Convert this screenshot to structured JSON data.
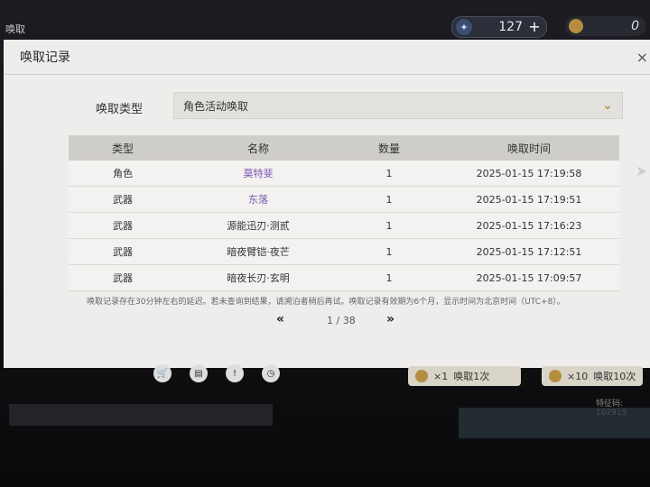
{
  "top": {
    "corner_label": "唤取",
    "currency": {
      "icon": "star-gem-icon",
      "value": "127",
      "plus": "+"
    },
    "currency2": {
      "icon": "coin-icon",
      "value": "0"
    }
  },
  "modal": {
    "title": "唤取记录",
    "close": "×",
    "type_label": "唤取类型",
    "type_value": "角色活动唤取",
    "columns": [
      "类型",
      "名称",
      "数量",
      "唤取时间"
    ],
    "rows": [
      {
        "type": "角色",
        "name": "莫特斐",
        "qty": "1",
        "time": "2025-01-15 17:19:58"
      },
      {
        "type": "武器",
        "name": "东落",
        "qty": "1",
        "time": "2025-01-15 17:19:51"
      },
      {
        "type": "武器",
        "name": "源能迅刃·测贰",
        "qty": "1",
        "time": "2025-01-15 17:16:23"
      },
      {
        "type": "武器",
        "name": "暗夜臂铠·夜芒",
        "qty": "1",
        "time": "2025-01-15 17:12:51"
      },
      {
        "type": "武器",
        "name": "暗夜长刃·玄明",
        "qty": "1",
        "time": "2025-01-15 17:09:57"
      }
    ],
    "note": "唤取记录存在30分钟左右的延迟。若未查询到结果，请溯泊者稍后再试。唤取记录有效期为6个月，显示时间为北京时间（UTC+8）。",
    "pager": {
      "prev": "«",
      "page": "1 / 38",
      "next": "»"
    }
  },
  "bottom": {
    "pull1_count": "×1",
    "pull1_label": "唤取1次",
    "pull10_count": "×10",
    "pull10_label": "唤取10次",
    "uid": "特征码: 102915"
  },
  "colors": {
    "accent": "#b07a20",
    "highlight_name": "#7a55b0"
  }
}
